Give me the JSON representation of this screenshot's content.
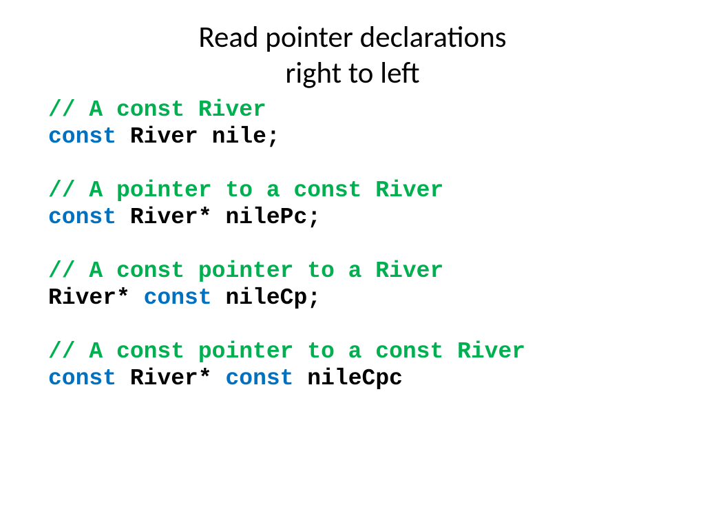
{
  "title": {
    "line1": "Read pointer declarations",
    "line2": "right to left"
  },
  "blocks": [
    {
      "comment": "// A const River",
      "code": [
        {
          "t": "const",
          "c": "kw"
        },
        {
          "t": " River nile;",
          "c": ""
        }
      ]
    },
    {
      "comment": "// A pointer to a const River",
      "code": [
        {
          "t": "const",
          "c": "kw"
        },
        {
          "t": " River* nilePc;",
          "c": ""
        }
      ]
    },
    {
      "comment": "// A const pointer to a River",
      "code": [
        {
          "t": "River* ",
          "c": ""
        },
        {
          "t": "const",
          "c": "kw"
        },
        {
          "t": " nileCp;",
          "c": ""
        }
      ]
    },
    {
      "comment": "// A const pointer to a const River",
      "code": [
        {
          "t": "const",
          "c": "kw"
        },
        {
          "t": " River* ",
          "c": ""
        },
        {
          "t": "const",
          "c": "kw"
        },
        {
          "t": " nileCpc",
          "c": ""
        }
      ]
    }
  ]
}
